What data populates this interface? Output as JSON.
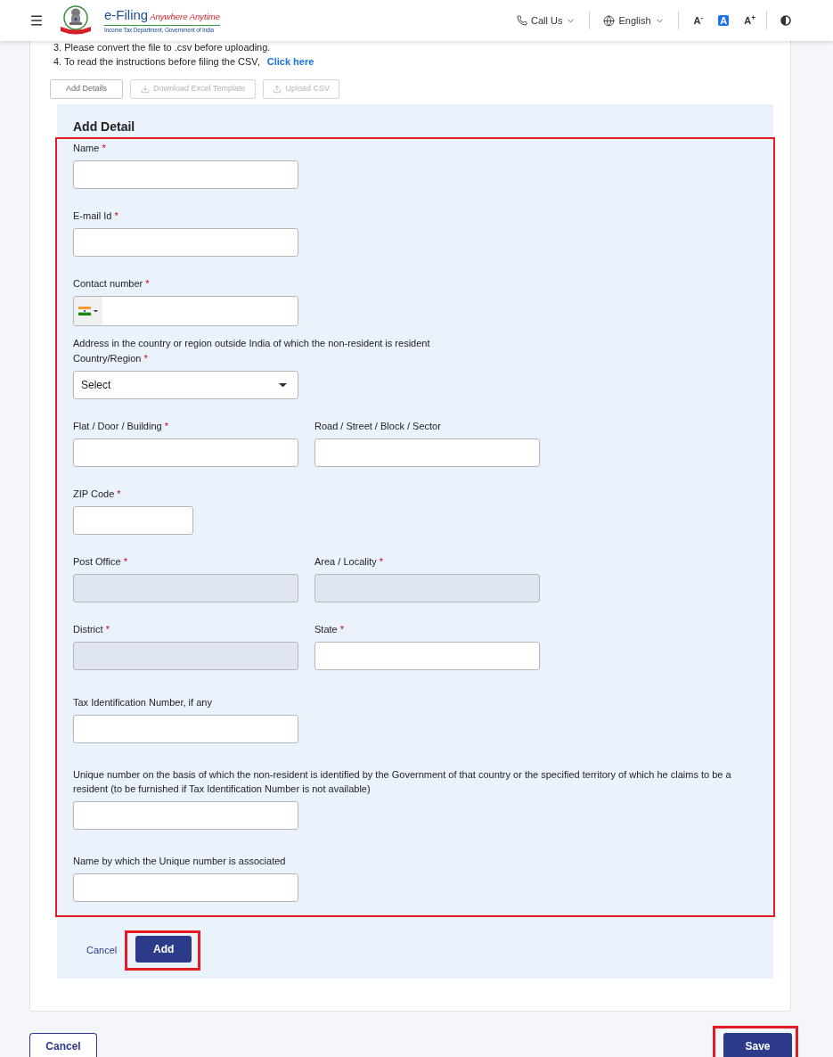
{
  "header": {
    "logo": {
      "title": "e-Filing",
      "tagline": "Anywhere Anytime",
      "subtitle": "Income Tax Department, Government of India"
    },
    "menus": [
      {
        "kind": "phone",
        "label": "Call Us"
      },
      {
        "kind": "language",
        "label": "English"
      }
    ],
    "text_size": [
      {
        "label": "A$^{-}$",
        "selected": false
      },
      {
        "label": "A",
        "selected": true
      },
      {
        "label": "A$^{+}$",
        "selected": false
      }
    ]
  },
  "instructions": [
    {
      "text": "3. Please convert the file to .csv before uploading."
    },
    {
      "text": "4. To read the instructions before filing the CSV,",
      "link": "Click here"
    }
  ],
  "toolbar": [
    {
      "kind": "plain",
      "label": "Add Details",
      "disabled": false
    },
    {
      "kind": "download",
      "label": "Download Excel Template",
      "disabled": true
    },
    {
      "kind": "upload",
      "label": "Upload CSV",
      "disabled": true
    }
  ],
  "add_detail": {
    "title": "Add Detail",
    "fields_highlighted": true,
    "contact_fields": [
      {
        "label": "Name",
        "required_mark": "*",
        "kind": "text",
        "disabled": false
      },
      {
        "label": "E-mail Id",
        "required_mark": "*",
        "kind": "text",
        "disabled": false
      },
      {
        "label": "Contact number",
        "required_mark": "*",
        "kind": "phone",
        "disabled": false
      }
    ],
    "address": {
      "note": "Address in the country or region outside India of which the non-resident is resident",
      "rows": [
        [
          {
            "label": "Country/Region",
            "required_mark": "*",
            "kind": "select",
            "placeholder": "Select",
            "disabled": false
          }
        ],
        [
          {
            "label": "Flat / Door / Building",
            "required_mark": "*",
            "kind": "text",
            "disabled": false
          },
          {
            "label": "Road / Street / Block / Sector",
            "kind": "text",
            "disabled": false
          }
        ],
        [
          {
            "label": "ZIP Code",
            "required_mark": "*",
            "kind": "zip",
            "disabled": false
          }
        ],
        [
          {
            "label": "Post Office",
            "required_mark": "*",
            "kind": "text",
            "disabled": true
          },
          {
            "label": "Area / Locality",
            "required_mark": "*",
            "kind": "text",
            "disabled": true
          }
        ],
        [
          {
            "label": "District",
            "required_mark": "*",
            "kind": "text",
            "disabled": true
          },
          {
            "label": "State",
            "required_mark": "*",
            "kind": "text",
            "disabled": false
          }
        ]
      ]
    },
    "identity_fields": [
      {
        "label": "Tax Identification Number, if any",
        "kind": "text",
        "disabled": false
      },
      {
        "label": "Unique number on the basis of which the non-resident is identified by the Government of that country or the specified territory of which he claims to be a resident (to be furnished if Tax Identification Number is not available)",
        "kind": "text",
        "disabled": false
      },
      {
        "label": "Name by which the Unique number is associated",
        "kind": "text",
        "disabled": false
      }
    ],
    "cancel": "Cancel",
    "add": {
      "label": "Add",
      "highlighted": true
    }
  },
  "footer": {
    "cancel": "Cancel",
    "save": {
      "label": "Save",
      "highlighted": true
    }
  }
}
